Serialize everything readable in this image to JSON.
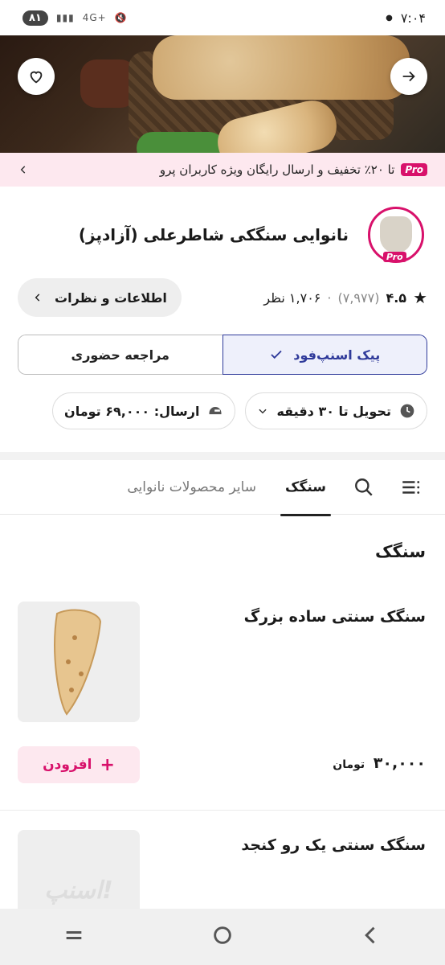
{
  "status_bar": {
    "time": "۷:۰۴",
    "battery": "۸۱",
    "network": "4G+"
  },
  "hero": {
    "favorite_icon": "heart-icon",
    "back_icon": "arrow-right-icon"
  },
  "pro_banner": {
    "badge": "Pro",
    "text": "تا ۲۰٪ تخفیف و ارسال رایگان ویژه کاربران پرو"
  },
  "vendor": {
    "name": "نانوایی سنگکی شاطرعلی (آزادپز)",
    "logo_badge": "Pro"
  },
  "rating": {
    "score": "۴.۵",
    "count": "(۷,۹۷۷)",
    "separator": "·",
    "reviews": "۱,۷۰۶ نظر"
  },
  "info_button": {
    "label": "اطلاعات و نظرات"
  },
  "delivery": {
    "option_active": "پیک اسنپ‌فود",
    "option_inactive": "مراجعه حضوری"
  },
  "chips": {
    "delivery_time": "تحویل تا ۳۰ دقیقه",
    "delivery_fee": "ارسال: ۶۹,۰۰۰ تومان"
  },
  "tabs": {
    "active": "سنگک",
    "other": "سایر محصولات نانوایی"
  },
  "section": {
    "title": "سنگک"
  },
  "products": [
    {
      "name": "سنگک سنتی ساده بزرگ",
      "price": "۳۰,۰۰۰",
      "currency": "تومان",
      "add_label": "افزودن"
    },
    {
      "name": "سنگک سنتی یک رو کنجد",
      "image_placeholder": "اسنپ!"
    }
  ],
  "colors": {
    "brand": "#d8116b",
    "active_blue": "#2f3a9a",
    "pro_bg": "#fde8ef"
  }
}
